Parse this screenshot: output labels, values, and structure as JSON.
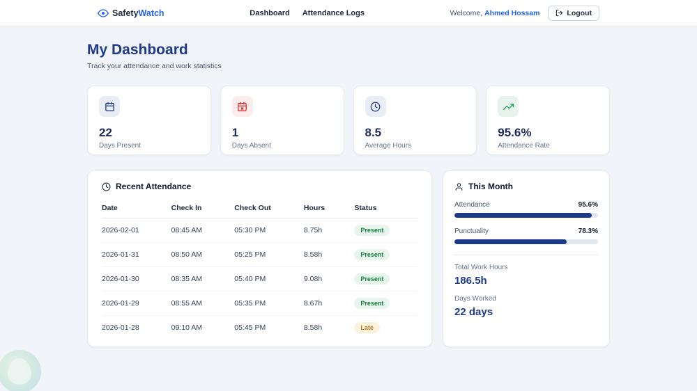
{
  "navbar": {
    "brand_safety": "Safety",
    "brand_watch": "Watch",
    "links": [
      {
        "label": "Dashboard"
      },
      {
        "label": "Attendance Logs"
      }
    ],
    "welcome_prefix": "Welcome, ",
    "welcome_name": "Ahmed Hossam",
    "logout_label": "Logout"
  },
  "header": {
    "title": "My Dashboard",
    "subtitle": "Track your attendance and work statistics"
  },
  "stats": [
    {
      "icon": "calendar-icon",
      "value": "22",
      "label": "Days Present"
    },
    {
      "icon": "calendar-absent-icon",
      "value": "1",
      "label": "Days Absent"
    },
    {
      "icon": "clock-icon",
      "value": "8.5",
      "label": "Average Hours"
    },
    {
      "icon": "trending-up-icon",
      "value": "95.6%",
      "label": "Attendance Rate"
    }
  ],
  "recent": {
    "title": "Recent Attendance",
    "columns": [
      "Date",
      "Check In",
      "Check Out",
      "Hours",
      "Status"
    ],
    "rows": [
      {
        "date": "2026-02-01",
        "check_in": "08:45 AM",
        "check_out": "05:30 PM",
        "hours": "8.75h",
        "status": "Present"
      },
      {
        "date": "2026-01-31",
        "check_in": "08:50 AM",
        "check_out": "05:25 PM",
        "hours": "8.58h",
        "status": "Present"
      },
      {
        "date": "2026-01-30",
        "check_in": "08:35 AM",
        "check_out": "05:40 PM",
        "hours": "9.08h",
        "status": "Present"
      },
      {
        "date": "2026-01-29",
        "check_in": "08:55 AM",
        "check_out": "05:35 PM",
        "hours": "8.67h",
        "status": "Present"
      },
      {
        "date": "2026-01-28",
        "check_in": "09:10 AM",
        "check_out": "05:45 PM",
        "hours": "8.58h",
        "status": "Late"
      }
    ]
  },
  "month": {
    "title": "This Month",
    "attendance_label": "Attendance",
    "attendance_value": "95.6%",
    "attendance_pct": 95.6,
    "punctuality_label": "Punctuality",
    "punctuality_value": "78.3%",
    "punctuality_pct": 78.3,
    "total_hours_label": "Total Work Hours",
    "total_hours_value": "186.5h",
    "days_worked_label": "Days Worked",
    "days_worked_value": "22 days"
  },
  "colors": {
    "navy": "#1e3a8a",
    "blue_accent": "#2563eb",
    "present_green": "#15803d",
    "late_amber": "#b7791f",
    "absent_red": "#dc2626",
    "page_bg": "#f1f5f9"
  }
}
